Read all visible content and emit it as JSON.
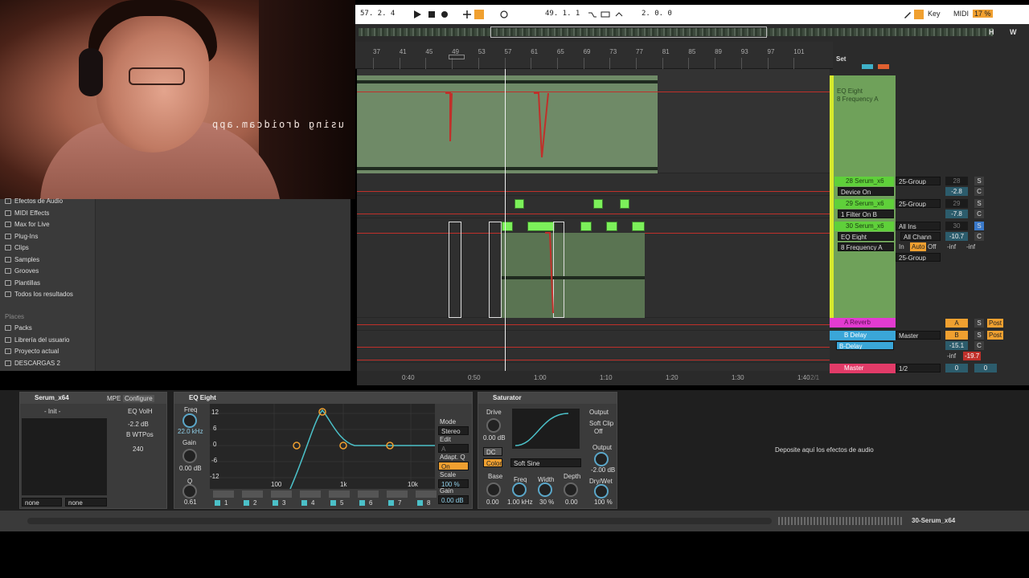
{
  "webcam": {
    "caption": "using droidcam.app"
  },
  "transport": {
    "position": "57.  2.  4",
    "loop_start": "49.  1.  1",
    "loop_length": "2.  0.  0",
    "key_label": "Key",
    "midi_label": "MIDI",
    "cpu": "17 %"
  },
  "overview": {
    "h_label": "H",
    "w_label": "W"
  },
  "ruler": {
    "bars": [
      "37",
      "41",
      "45",
      "49",
      "53",
      "57",
      "61",
      "65",
      "69",
      "73",
      "77",
      "81",
      "85",
      "89",
      "93",
      "97",
      "101"
    ],
    "set_label": "Set"
  },
  "browser": {
    "items": [
      "Efectos de Audio",
      "MIDI Effects",
      "Max for Live",
      "Plug-Ins",
      "Clips",
      "Samples",
      "Grooves",
      "Plantillas",
      "Todos los resultados"
    ],
    "places_label": "Places",
    "places": [
      "Packs",
      "Librería del usuario",
      "Proyecto actual",
      "DESCARGAS 2"
    ]
  },
  "timebar": {
    "times": [
      "0:40",
      "0:50",
      "1:00",
      "1:10",
      "1:20",
      "1:30",
      "1:40"
    ],
    "page": "2/1"
  },
  "mixer": {
    "lane_device": "EQ Eight",
    "lane_param": "8 Frequency A",
    "tracks": [
      {
        "name": "28 Serum_x6",
        "route": "25-Group",
        "param": "Device On",
        "vol": "28",
        "pan": "-2.8",
        "c": "C",
        "s": "S"
      },
      {
        "name": "29 Serum_x6",
        "route": "25-Group",
        "param": "1 Filter On B",
        "vol": "29",
        "pan": "-7.8",
        "c": "C",
        "s": "S"
      },
      {
        "name": "30 Serum_x6",
        "route": "All Ins",
        "param": "EQ Eight",
        "param2": "8 Frequency A",
        "sub": "All Chann",
        "vol": "30",
        "pan": "-10.7",
        "c": "C",
        "s": "S"
      }
    ],
    "monitor": {
      "in": "In",
      "auto": "Auto",
      "off": "Off",
      "inf1": "-inf",
      "inf2": "-inf",
      "route2": "25-Group"
    },
    "returns": [
      {
        "name": "A Reverb",
        "route": "",
        "letter": "A",
        "s": "S",
        "post": "Post"
      },
      {
        "name": "B Delay",
        "route": "Master",
        "letter": "B",
        "s": "S",
        "post": "Post",
        "sub": "B-Delay",
        "vol": "-15.1",
        "c": "C",
        "inf": "-inf",
        "peak": "-19.7"
      }
    ],
    "master": {
      "name": "Master",
      "cue": "1/2",
      "v1": "0",
      "v2": "0"
    }
  },
  "devices": {
    "serum": {
      "title": "Serum_x64",
      "mpe": "MPE",
      "configure": "Configure",
      "preset": "- Init -",
      "param1": "EQ VolH",
      "param1_val": "-2.2 dB",
      "param2": "B WTPos",
      "param2_val": "240",
      "sel1": "none",
      "sel2": "none"
    },
    "eq": {
      "title": "EQ Eight",
      "freq_label": "Freq",
      "freq_val": "22.0 kHz",
      "gain_label": "Gain",
      "gain_val": "0.00 dB",
      "q_label": "Q",
      "q_val": "0.61",
      "db_ticks": [
        "12",
        "6",
        "0",
        "-6",
        "-12"
      ],
      "hz_ticks": [
        "100",
        "1k",
        "10k"
      ],
      "mode_label": "Mode",
      "mode_val": "Stereo",
      "edit_label": "Edit",
      "edit_val": "A",
      "adapt_label": "Adapt. Q",
      "adapt_val": "On",
      "scale_label": "Scale",
      "scale_val": "100 %",
      "gain2_label": "Gain",
      "gain2_val": "0.00 dB",
      "bands": [
        "1",
        "2",
        "3",
        "4",
        "5",
        "6",
        "7",
        "8"
      ]
    },
    "saturator": {
      "title": "Saturator",
      "drive_label": "Drive",
      "drive_val": "0.00 dB",
      "dc_label": "DC",
      "color_label": "Color",
      "output_label": "Output",
      "soft_clip": "Soft Clip",
      "soft_clip_val": "Off",
      "output2_label": "Output",
      "output_val": "-2.00 dB",
      "mode": "Soft Sine",
      "base_label": "Base",
      "base_val": "0.00",
      "freq_label": "Freq",
      "freq_val": "1.00 kHz",
      "width_label": "Width",
      "width_val": "30 %",
      "depth_label": "Depth",
      "depth_val": "0.00",
      "drywet_label": "Dry/Wet",
      "drywet_val": "100 %"
    },
    "drop_hint": "Deposite aquí los efectos de audio"
  },
  "statusbar": {
    "track": "30-Serum_x64"
  },
  "colors": {
    "accent_orange": "#f0a030",
    "clip_green": "#6f8a67",
    "note_green": "#7cf05a",
    "automation_red": "#c0302a",
    "knob_blue": "#5aa6c8"
  }
}
